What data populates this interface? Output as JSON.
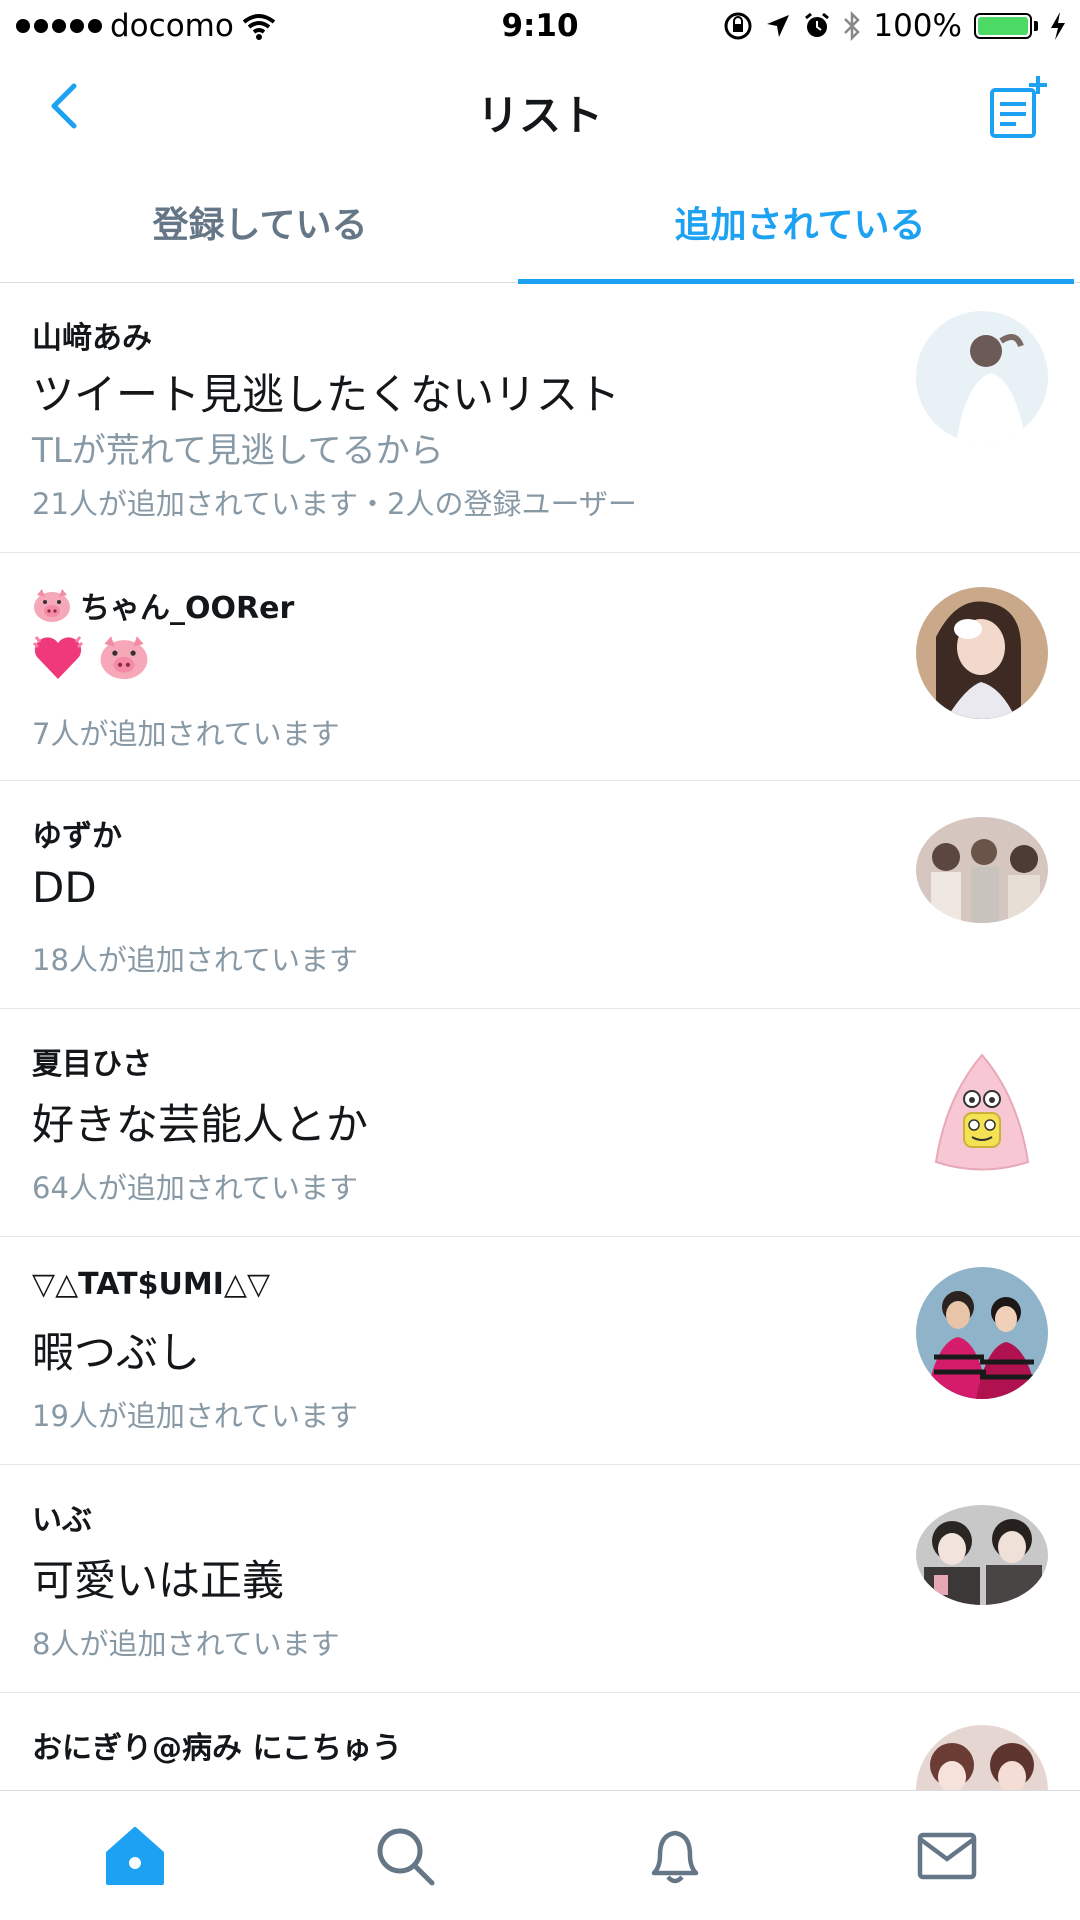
{
  "status_bar": {
    "carrier": "docomo",
    "time": "9:10",
    "battery": "100%"
  },
  "nav": {
    "title": "リスト"
  },
  "tabs": [
    {
      "label": "登録している",
      "active": false
    },
    {
      "label": "追加されている",
      "active": true
    }
  ],
  "lists": [
    {
      "owner": "山﨑あみ",
      "name": "ツイート見逃したくないリスト",
      "description": "TLが荒れて見逃してるから",
      "meta": "21人が追加されています・2人の登録ユーザー"
    },
    {
      "owner": "ちゃん_OORer",
      "owner_prefix_icon": "pig-face-emoji",
      "name_icons": [
        "heart-emoji",
        "pig-face-emoji"
      ],
      "meta": "7人が追加されています"
    },
    {
      "owner": "ゆずか",
      "name": "DD",
      "meta": "18人が追加されています"
    },
    {
      "owner": "夏目ひさ",
      "name": "好きな芸能人とか",
      "meta": "64人が追加されています"
    },
    {
      "owner": "▽△TAT$UMI△▽",
      "name": "暇つぶし",
      "meta": "19人が追加されています"
    },
    {
      "owner": "いぶ",
      "name": "可愛いは正義",
      "meta": "8人が追加されています"
    },
    {
      "owner": "おにぎり@病み にこちゅう"
    }
  ],
  "tab_bar": {
    "items": [
      "home-icon",
      "search-icon",
      "notifications-icon",
      "messages-icon"
    ],
    "active": "home-icon"
  },
  "colors": {
    "accent": "#1da1f2",
    "secondary_text": "#8899a6",
    "tab_inactive": "#657786"
  }
}
